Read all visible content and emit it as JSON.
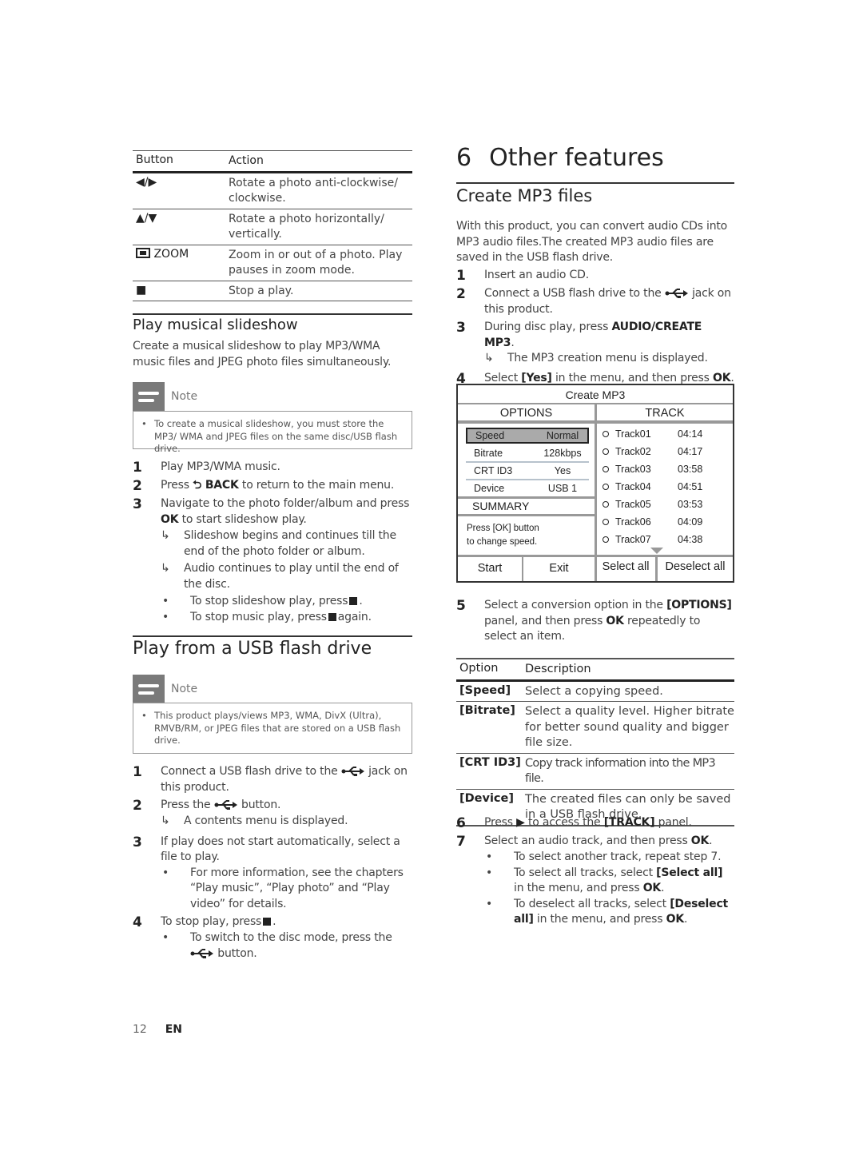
{
  "button_table": {
    "headers": [
      "Button",
      "Action"
    ],
    "rows": [
      {
        "button_icon": "left-right-arrows-icon",
        "button": "◀/▶",
        "action": "Rotate a photo anti-clockwise/ clockwise."
      },
      {
        "button_icon": "up-down-arrows-icon",
        "button": "▲/▼",
        "action": "Rotate a photo horizontally/ vertically."
      },
      {
        "button_icon": "zoom-icon",
        "button": "ZOOM",
        "action": "Zoom in or out of a photo. Play pauses in zoom mode."
      },
      {
        "button_icon": "stop-icon",
        "button": "■",
        "action": "Stop a play."
      }
    ]
  },
  "slideshow": {
    "heading": "Play musical slideshow",
    "intro": "Create a musical slideshow to play MP3/WMA music files and JPEG photo files simultaneously.",
    "note_label": "Note",
    "note_text": "To create a musical slideshow, you must store the MP3/ WMA and JPEG files on the same disc/USB flash drive.",
    "steps": [
      {
        "n": "1",
        "text": "Play MP3/WMA music."
      },
      {
        "n": "2",
        "pre": "Press ",
        "bold": "BACK",
        "post": " to return to the main menu."
      },
      {
        "n": "3",
        "pre": "Navigate to the photo folder/album and press ",
        "bold": "OK",
        "post": " to start slideshow play."
      }
    ],
    "results": [
      "Slideshow begins and continues till the end of the photo folder or album.",
      "Audio continues to play until the end of the disc."
    ],
    "bullets": [
      {
        "pre": "To stop slideshow play, press",
        "post": "."
      },
      {
        "pre": "To stop music play, press",
        "post": "again."
      }
    ]
  },
  "usb": {
    "heading": "Play from a USB flash drive",
    "note_label": "Note",
    "note_text": "This product plays/views MP3, WMA, DivX (Ultra), RMVB/RM, or JPEG files that are stored on a USB flash drive.",
    "step1_pre": "Connect a USB flash drive to the",
    "step1_post": "jack on this product.",
    "step2_pre": "Press the",
    "step2_post": "button.",
    "step2_result": "A contents menu is displayed.",
    "step3": "If play does not start automatically, select a file to play.",
    "step3_bullet": "For more information, see the chapters “Play music”, “Play photo” and “Play video” for details.",
    "step4_pre": "To stop play, press",
    "step4_post": ".",
    "step4_bullet_pre": "To switch to the disc mode, press the",
    "step4_bullet_post": "button."
  },
  "chapter": {
    "number": "6",
    "title": "Other features",
    "section": "Create MP3 files",
    "intro": "With this product, you can convert audio CDs into MP3 audio files.The created MP3 audio files are saved in the USB flash drive.",
    "step1": "Insert an audio CD.",
    "step2_pre": "Connect a USB flash drive to the",
    "step2_post": "jack on this product.",
    "step3_pre": "During disc play, press ",
    "step3_bold": "AUDIO/CREATE MP3",
    "step3_post": ".",
    "step3_result": "The MP3 creation menu is displayed.",
    "step4_pre": "Select ",
    "step4_b1": "[Yes]",
    "step4_mid": " in the menu, and then press ",
    "step4_b2": "OK",
    "step4_post": ".",
    "step5_pre": "Select a conversion option in the ",
    "step5_b1": "[OPTIONS]",
    "step5_mid": " panel, and then press ",
    "step5_b2": "OK",
    "step5_post": " repeatedly to select an item.",
    "step6_pre": "Press ",
    "step6_mid": " to access the ",
    "step6_b": "[TRACK]",
    "step6_post": " panel.",
    "step7_pre": "Select an audio track, and then press ",
    "step7_b": "OK",
    "step7_post": ".",
    "b1": "To select another track, repeat step 7.",
    "b2_pre": "To select all tracks, select ",
    "b2_b": "[Select all]",
    "b2_mid": " in the menu, and press ",
    "b2_b2": "OK",
    "b2_post": ".",
    "b3_pre": "To deselect all tracks, select ",
    "b3_b": "[Deselect all]",
    "b3_mid": " in the menu, and press ",
    "b3_b2": "OK",
    "b3_post": "."
  },
  "mp3_screen": {
    "title": "Create MP3",
    "options_header": "OPTIONS",
    "track_header": "TRACK",
    "options": [
      {
        "key": "Speed",
        "value": "Normal",
        "selected": true
      },
      {
        "key": "Bitrate",
        "value": "128kbps"
      },
      {
        "key": "CRT ID3",
        "value": "Yes"
      },
      {
        "key": "Device",
        "value": "USB 1"
      }
    ],
    "summary_label": "SUMMARY",
    "summary_text_1": "Press [OK] button",
    "summary_text_2": "to change speed.",
    "tracks": [
      {
        "name": "Track01",
        "time": "04:14"
      },
      {
        "name": "Track02",
        "time": "04:17"
      },
      {
        "name": "Track03",
        "time": "03:58"
      },
      {
        "name": "Track04",
        "time": "04:51"
      },
      {
        "name": "Track05",
        "time": "03:53"
      },
      {
        "name": "Track06",
        "time": "04:09"
      },
      {
        "name": "Track07",
        "time": "04:38"
      }
    ],
    "buttons": [
      "Start",
      "Exit",
      "Select all",
      "Deselect all"
    ]
  },
  "option_table": {
    "headers": [
      "Option",
      "Description"
    ],
    "rows": [
      {
        "option": "[Speed]",
        "description": "Select a copying speed."
      },
      {
        "option": "[Bitrate]",
        "description": "Select a quality level. Higher bitrate for better sound quality and bigger file size."
      },
      {
        "option": "[CRT ID3]",
        "description": "Copy track information into the MP3 file."
      },
      {
        "option": "[Device]",
        "description": "The created files can only be saved in a USB flash drive."
      }
    ]
  },
  "footer": {
    "page": "12",
    "lang": "EN"
  }
}
